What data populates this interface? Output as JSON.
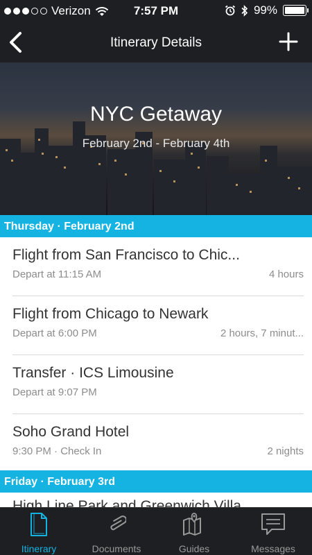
{
  "status_bar": {
    "carrier": "Verizon",
    "time": "7:57 PM",
    "battery": "99%",
    "battery_level": 0.99
  },
  "nav": {
    "title": "Itinerary Details",
    "back_icon": "chevron-left-icon",
    "add_icon": "plus-icon"
  },
  "trip": {
    "title": "NYC Getaway",
    "dates": "February 2nd - February 4th"
  },
  "sections": [
    {
      "header": "Thursday · February 2nd",
      "items": [
        {
          "name": "Flight from San Francisco to Chic...",
          "detail": "Depart at 11:15 AM",
          "duration": "4 hours"
        },
        {
          "name": "Flight from Chicago to Newark",
          "detail": "Depart at 6:00 PM",
          "duration": "2 hours, 7 minut..."
        },
        {
          "name": "Transfer · ICS Limousine",
          "detail": "Depart at 9:07 PM",
          "duration": ""
        },
        {
          "name": "Soho Grand Hotel",
          "detail": "9:30 PM · Check In",
          "duration": "2 nights"
        }
      ]
    },
    {
      "header": "Friday · February 3rd",
      "items": [
        {
          "name": "High Line Park and Greenwich Villa",
          "detail": "",
          "duration": ""
        }
      ]
    }
  ],
  "tabs": [
    {
      "label": "Itinerary",
      "icon": "document-icon",
      "active": true
    },
    {
      "label": "Documents",
      "icon": "paperclip-icon",
      "active": false
    },
    {
      "label": "Guides",
      "icon": "map-icon",
      "active": false
    },
    {
      "label": "Messages",
      "icon": "message-icon",
      "active": false
    }
  ],
  "colors": {
    "accent": "#15b3e1",
    "bar_background": "#1e1f22",
    "tab_inactive": "#9a9a9a"
  }
}
